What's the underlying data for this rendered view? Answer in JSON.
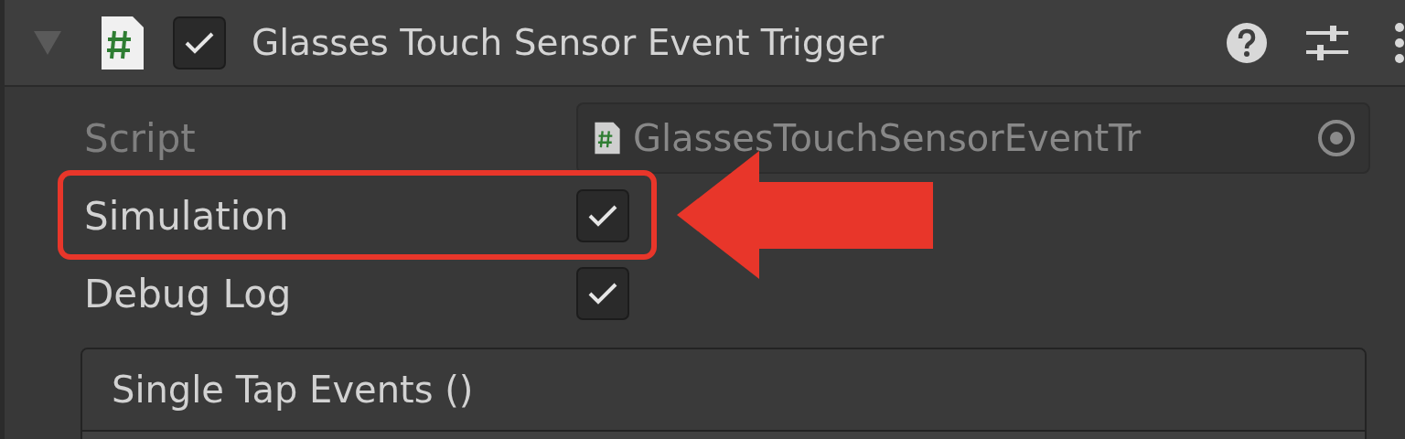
{
  "component": {
    "title": "Glasses Touch Sensor Event Trigger",
    "expanded": true,
    "enabled": true
  },
  "fields": [
    {
      "kind": "object",
      "label": "Script",
      "value": "GlassesTouchSensorEventTr",
      "disabled": true
    },
    {
      "kind": "toggle",
      "label": "Simulation",
      "checked": true,
      "highlighted": true
    },
    {
      "kind": "toggle",
      "label": "Debug Log",
      "checked": true,
      "highlighted": false
    }
  ],
  "event": {
    "title": "Single Tap Events ()"
  }
}
